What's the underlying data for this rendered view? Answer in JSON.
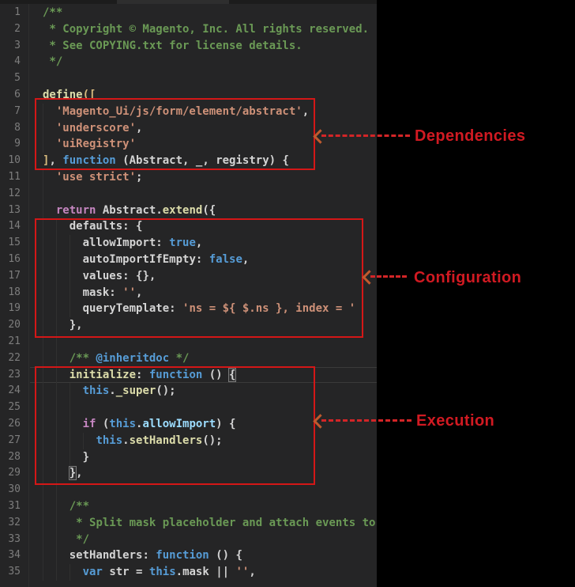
{
  "editor": {
    "background": "#252526",
    "language": "javascript",
    "lines": [
      {
        "n": "1",
        "indent": 0,
        "tokens": [
          [
            "/**",
            "com"
          ]
        ]
      },
      {
        "n": "2",
        "indent": 1,
        "tokens": [
          [
            " * Copyright © Magento, Inc. All rights reserved.",
            "com"
          ]
        ]
      },
      {
        "n": "3",
        "indent": 1,
        "tokens": [
          [
            " * See COPYING.txt for license details.",
            "com"
          ]
        ]
      },
      {
        "n": "4",
        "indent": 1,
        "tokens": [
          [
            " */",
            "com"
          ]
        ]
      },
      {
        "n": "5",
        "indent": 0,
        "tokens": []
      },
      {
        "n": "6",
        "indent": 0,
        "tokens": [
          [
            "define",
            "fn"
          ],
          [
            "([",
            "gold"
          ]
        ]
      },
      {
        "n": "7",
        "indent": 2,
        "tokens": [
          [
            "  ",
            "def"
          ],
          [
            "'Magento_Ui/js/form/element/abstract'",
            "str"
          ],
          [
            ",",
            "def"
          ]
        ]
      },
      {
        "n": "8",
        "indent": 2,
        "tokens": [
          [
            "  ",
            "def"
          ],
          [
            "'underscore'",
            "str"
          ],
          [
            ",",
            "def"
          ]
        ]
      },
      {
        "n": "9",
        "indent": 2,
        "tokens": [
          [
            "  ",
            "def"
          ],
          [
            "'uiRegistry'",
            "str"
          ]
        ]
      },
      {
        "n": "10",
        "indent": 0,
        "tokens": [
          [
            "]",
            "gold"
          ],
          [
            ", ",
            "def"
          ],
          [
            "function",
            "kw"
          ],
          [
            " (",
            "def"
          ],
          [
            "Abstract",
            "def"
          ],
          [
            ", ",
            "def"
          ],
          [
            "_",
            "def"
          ],
          [
            ", ",
            "def"
          ],
          [
            "registry",
            "def"
          ],
          [
            ") {",
            "def"
          ]
        ]
      },
      {
        "n": "11",
        "indent": 2,
        "tokens": [
          [
            "  ",
            "def"
          ],
          [
            "'use strict'",
            "str"
          ],
          [
            ";",
            "def"
          ]
        ]
      },
      {
        "n": "12",
        "indent": 2,
        "tokens": []
      },
      {
        "n": "13",
        "indent": 2,
        "tokens": [
          [
            "  ",
            "def"
          ],
          [
            "return",
            "ctrl"
          ],
          [
            " ",
            "def"
          ],
          [
            "Abstract",
            "def"
          ],
          [
            ".",
            "def"
          ],
          [
            "extend",
            "fn"
          ],
          [
            "({",
            "def"
          ]
        ]
      },
      {
        "n": "14",
        "indent": 4,
        "tokens": [
          [
            "    ",
            "def"
          ],
          [
            "defaults",
            "def"
          ],
          [
            ": {",
            "def"
          ]
        ]
      },
      {
        "n": "15",
        "indent": 6,
        "tokens": [
          [
            "      ",
            "def"
          ],
          [
            "allowImport",
            "def"
          ],
          [
            ": ",
            "def"
          ],
          [
            "true",
            "kw"
          ],
          [
            ",",
            "def"
          ]
        ]
      },
      {
        "n": "16",
        "indent": 6,
        "tokens": [
          [
            "      ",
            "def"
          ],
          [
            "autoImportIfEmpty",
            "def"
          ],
          [
            ": ",
            "def"
          ],
          [
            "false",
            "kw"
          ],
          [
            ",",
            "def"
          ]
        ]
      },
      {
        "n": "17",
        "indent": 6,
        "tokens": [
          [
            "      ",
            "def"
          ],
          [
            "values",
            "def"
          ],
          [
            ": {},",
            "def"
          ]
        ]
      },
      {
        "n": "18",
        "indent": 6,
        "tokens": [
          [
            "      ",
            "def"
          ],
          [
            "mask",
            "def"
          ],
          [
            ": ",
            "def"
          ],
          [
            "''",
            "str"
          ],
          [
            ",",
            "def"
          ]
        ]
      },
      {
        "n": "19",
        "indent": 6,
        "tokens": [
          [
            "      ",
            "def"
          ],
          [
            "queryTemplate",
            "def"
          ],
          [
            ": ",
            "def"
          ],
          [
            "'ns = ${ $.ns }, index = '",
            "str"
          ]
        ]
      },
      {
        "n": "20",
        "indent": 4,
        "tokens": [
          [
            "    ",
            "def"
          ],
          [
            "},",
            "def"
          ]
        ]
      },
      {
        "n": "21",
        "indent": 4,
        "tokens": []
      },
      {
        "n": "22",
        "indent": 4,
        "tokens": [
          [
            "    ",
            "def"
          ],
          [
            "/** ",
            "com"
          ],
          [
            "@inheritdoc",
            "doctag"
          ],
          [
            " */",
            "com"
          ]
        ]
      },
      {
        "n": "23",
        "indent": 4,
        "tokens": [
          [
            "    ",
            "def"
          ],
          [
            "initialize",
            "fn"
          ],
          [
            ": ",
            "def"
          ],
          [
            "function",
            "kw"
          ],
          [
            " () ",
            "def"
          ],
          [
            "{",
            "bm"
          ]
        ]
      },
      {
        "n": "24",
        "indent": 6,
        "tokens": [
          [
            "      ",
            "def"
          ],
          [
            "this",
            "kw"
          ],
          [
            ".",
            "def"
          ],
          [
            "_super",
            "fn"
          ],
          [
            "();",
            "def"
          ]
        ]
      },
      {
        "n": "25",
        "indent": 6,
        "tokens": []
      },
      {
        "n": "26",
        "indent": 6,
        "tokens": [
          [
            "      ",
            "def"
          ],
          [
            "if",
            "ctrl"
          ],
          [
            " (",
            "def"
          ],
          [
            "this",
            "kw"
          ],
          [
            ".",
            "def"
          ],
          [
            "allowImport",
            "prop"
          ],
          [
            ") {",
            "def"
          ]
        ]
      },
      {
        "n": "27",
        "indent": 8,
        "tokens": [
          [
            "        ",
            "def"
          ],
          [
            "this",
            "kw"
          ],
          [
            ".",
            "def"
          ],
          [
            "setHandlers",
            "fn"
          ],
          [
            "();",
            "def"
          ]
        ]
      },
      {
        "n": "28",
        "indent": 6,
        "tokens": [
          [
            "      ",
            "def"
          ],
          [
            "}",
            "def"
          ]
        ]
      },
      {
        "n": "29",
        "indent": 4,
        "tokens": [
          [
            "    ",
            "def"
          ],
          [
            "}",
            "bm"
          ],
          [
            ",",
            "def"
          ]
        ]
      },
      {
        "n": "30",
        "indent": 4,
        "tokens": []
      },
      {
        "n": "31",
        "indent": 4,
        "tokens": [
          [
            "    ",
            "def"
          ],
          [
            "/**",
            "com"
          ]
        ]
      },
      {
        "n": "32",
        "indent": 5,
        "tokens": [
          [
            "     ",
            "def"
          ],
          [
            "* Split mask placeholder and attach events to",
            "com"
          ]
        ]
      },
      {
        "n": "33",
        "indent": 5,
        "tokens": [
          [
            "     ",
            "def"
          ],
          [
            "*/",
            "com"
          ]
        ]
      },
      {
        "n": "34",
        "indent": 4,
        "tokens": [
          [
            "    ",
            "def"
          ],
          [
            "setHandlers",
            "def"
          ],
          [
            ": ",
            "def"
          ],
          [
            "function",
            "kw"
          ],
          [
            " () {",
            "def"
          ]
        ]
      },
      {
        "n": "35",
        "indent": 6,
        "tokens": [
          [
            "      ",
            "def"
          ],
          [
            "var",
            "kw"
          ],
          [
            " ",
            "def"
          ],
          [
            "str",
            "def"
          ],
          [
            " = ",
            "def"
          ],
          [
            "this",
            "kw"
          ],
          [
            ".",
            "def"
          ],
          [
            "mask",
            "def"
          ],
          [
            " || ",
            "def"
          ],
          [
            "''",
            "str"
          ],
          [
            ",",
            "def"
          ]
        ]
      }
    ]
  },
  "palette": {
    "comment": "#6a9955",
    "string": "#ce9178",
    "keyword": "#569cd6",
    "control_keyword": "#c586c0",
    "function_name": "#dcdcaa",
    "property": "#9cdcfe",
    "default_text": "#d4d4d4",
    "line_number": "#7d7d7d",
    "annotation_red": "#d41717",
    "arrow_dash_red": "#d32527",
    "arrowhead_orange": "#c05a2e",
    "label_red": "#d11a22",
    "right_panel": "#000000"
  },
  "annotations": [
    {
      "id": "dependencies",
      "label": "Dependencies"
    },
    {
      "id": "configuration",
      "label": "Configuration"
    },
    {
      "id": "execution",
      "label": "Execution"
    }
  ]
}
